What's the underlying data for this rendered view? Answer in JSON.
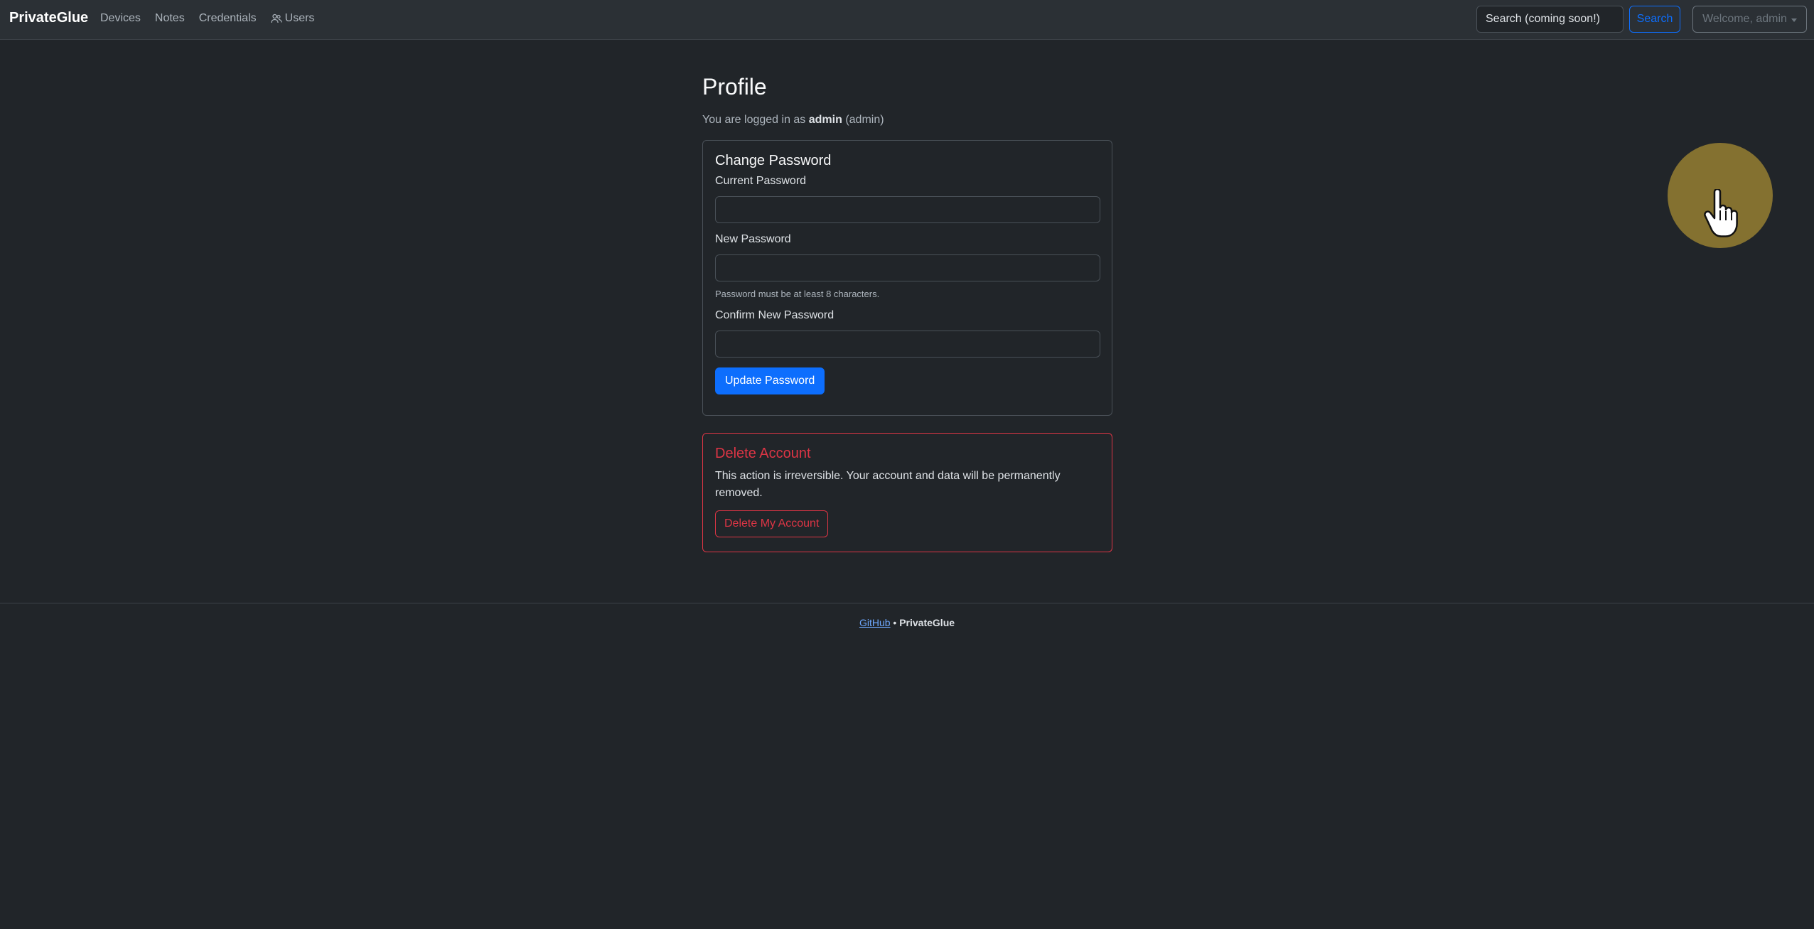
{
  "nav": {
    "brand": "PrivateGlue",
    "links": [
      {
        "label": "Devices"
      },
      {
        "label": "Notes"
      },
      {
        "label": "Credentials"
      },
      {
        "label": "Users",
        "icon": "users-icon"
      }
    ],
    "search_placeholder": "Search (coming soon!)",
    "search_button": "Search",
    "welcome": "Welcome, admin"
  },
  "profile": {
    "title": "Profile",
    "logged_prefix": "You are logged in as ",
    "username": "admin",
    "role": "(admin)"
  },
  "change_password": {
    "title": "Change Password",
    "current_label": "Current Password",
    "new_label": "New Password",
    "new_help": "Password must be at least 8 characters.",
    "confirm_label": "Confirm New Password",
    "submit": "Update Password"
  },
  "delete_account": {
    "title": "Delete Account",
    "text": "This action is irreversible. Your account and data will be permanently removed.",
    "button": "Delete My Account"
  },
  "footer": {
    "link": "GitHub",
    "separator": " • ",
    "brand": "PrivateGlue"
  },
  "colors": {
    "background": "#212529",
    "navbar": "#2b3035",
    "primary": "#0d6efd",
    "danger": "#dc3545",
    "cursor_highlight": "#8a7530"
  }
}
